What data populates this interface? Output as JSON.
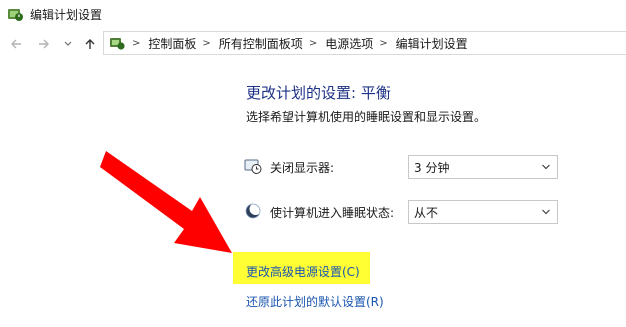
{
  "window": {
    "title": "编辑计划设置",
    "icon": "power-options-icon"
  },
  "navigation": {
    "back_icon": "arrow-left-icon",
    "forward_icon": "arrow-right-icon",
    "recent_icon": "chevron-down-icon",
    "up_icon": "arrow-up-icon"
  },
  "breadcrumb": {
    "items": [
      {
        "label": "控制面板"
      },
      {
        "label": "所有控制面板项"
      },
      {
        "label": "电源选项"
      },
      {
        "label": "编辑计划设置"
      }
    ]
  },
  "main": {
    "heading": "更改计划的设置: 平衡",
    "subtitle": "选择希望计算机使用的睡眠设置和显示设置。",
    "settings": [
      {
        "label": "关闭显示器:",
        "value": "3 分钟",
        "icon": "display-timer-icon"
      },
      {
        "label": "使计算机进入睡眠状态:",
        "value": "从不",
        "icon": "sleep-moon-icon"
      }
    ],
    "links": {
      "advanced": "更改高级电源设置(C)",
      "restore": "还原此计划的默认设置(R)"
    }
  },
  "annotation": {
    "arrow_color": "#ff0000",
    "highlight_color": "#ffff33"
  }
}
